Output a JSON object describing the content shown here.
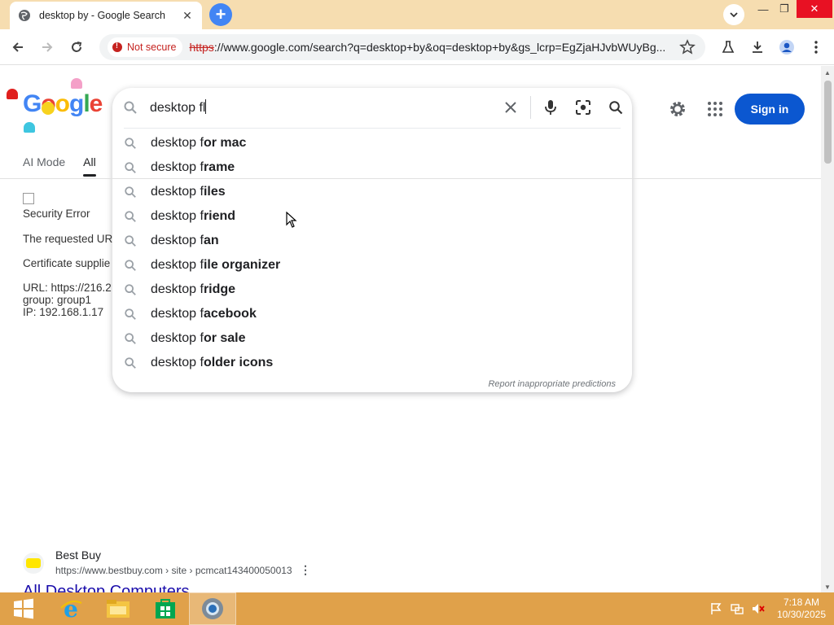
{
  "browser": {
    "tab_title": "desktop by - Google Search",
    "security_chip": "Not secure",
    "url_scheme": "https",
    "url_rest": "://www.google.com/search?q=desktop+by&oq=desktop+by&gs_lcrp=EgZjaHJvbWUyBg..."
  },
  "google": {
    "logo_letters": [
      "G",
      "o",
      "o",
      "g",
      "l",
      "e"
    ],
    "search_value": "desktop fl",
    "suggestions": [
      {
        "prefix": "desktop f",
        "bold": "or mac"
      },
      {
        "prefix": "desktop f",
        "bold": "rame"
      },
      {
        "prefix": "desktop f",
        "bold": "iles"
      },
      {
        "prefix": "desktop f",
        "bold": "riend"
      },
      {
        "prefix": "desktop f",
        "bold": "an"
      },
      {
        "prefix": "desktop f",
        "bold": "ile organizer"
      },
      {
        "prefix": "desktop f",
        "bold": "ridge"
      },
      {
        "prefix": "desktop f",
        "bold": "acebook"
      },
      {
        "prefix": "desktop f",
        "bold": "or sale"
      },
      {
        "prefix": "desktop f",
        "bold": "older icons"
      }
    ],
    "report_link": "Report inappropriate predictions",
    "signin_label": "Sign in",
    "tabs": [
      "AI Mode",
      "All"
    ],
    "active_tab": "All"
  },
  "error_page": {
    "title": "Security Error",
    "line1": "The requested UR",
    "line2": "Certificate supplie",
    "url_line": "URL: https://216.2",
    "group_line": "group: group1",
    "ip_line": "IP: 192.168.1.17"
  },
  "result": {
    "site_name": "Best Buy",
    "cite": "https://www.bestbuy.com › site › pcmcat143400050013",
    "title": "All Desktop Computers"
  },
  "taskbar": {
    "time": "7:18 AM",
    "date": "10/30/2025"
  },
  "colors": {
    "tabstrip": "#f6ddb0",
    "taskbar": "#e0a14a",
    "signin": "#0b57d0",
    "insecure": "#c5221f"
  }
}
